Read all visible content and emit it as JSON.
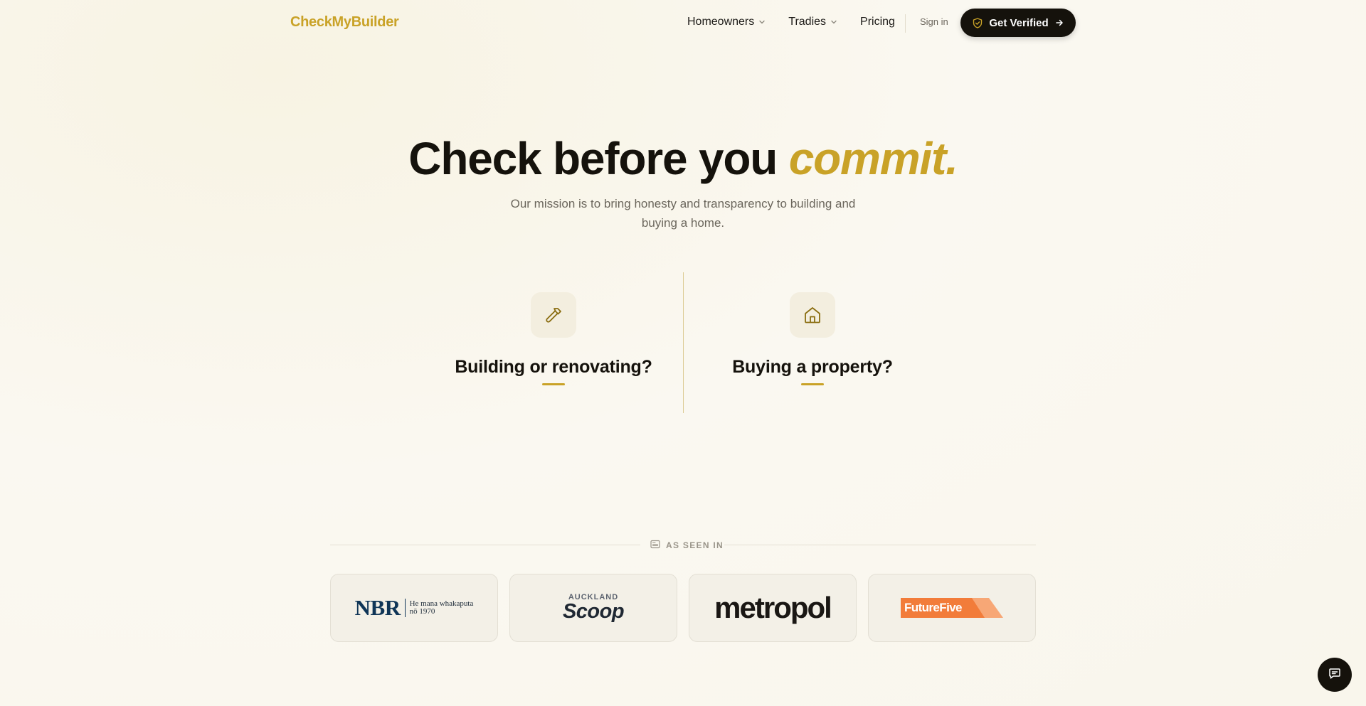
{
  "nav": {
    "logo": "CheckMyBuilder",
    "homeowners": "Homeowners",
    "tradies": "Tradies",
    "pricing": "Pricing",
    "signin": "Sign in",
    "cta": "Get Verified"
  },
  "hero": {
    "title_main": "Check before you ",
    "title_accent": "commit.",
    "subtitle": "Our mission is to bring honesty and transparency to building and buying a home."
  },
  "choices": [
    {
      "title": "Building or renovating?",
      "icon": "hammer-icon"
    },
    {
      "title": "Buying a property?",
      "icon": "house-icon"
    }
  ],
  "seen_in": {
    "label": "AS SEEN IN",
    "logos": {
      "nbr_main": "NBR",
      "nbr_tag_line1": "He mana whakaputa",
      "nbr_tag_line2": "nō 1970",
      "scoop_top": "AUCKLAND",
      "scoop_main": "Scoop",
      "metropol": "metropol",
      "futurefive": "FutureFive"
    }
  },
  "colors": {
    "accent": "#c9a227",
    "dark": "#15120c",
    "muted": "#6b665c"
  }
}
